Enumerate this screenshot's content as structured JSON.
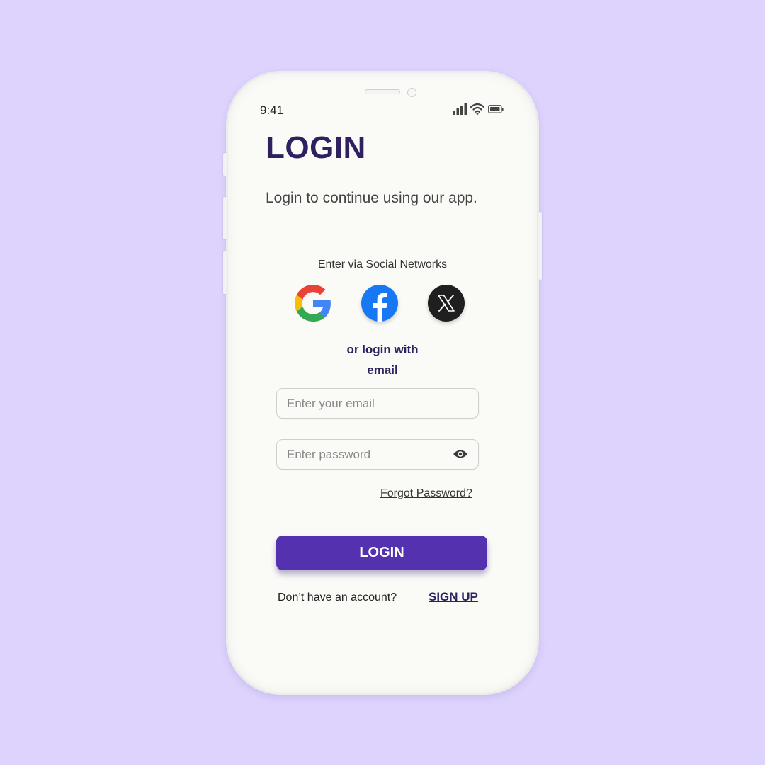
{
  "status_bar": {
    "time": "9:41",
    "icons": [
      "signal-icon",
      "wifi-icon",
      "battery-icon"
    ]
  },
  "header": {
    "title": "LOGIN",
    "subtitle": "Login to continue using our app."
  },
  "social": {
    "label": "Enter via Social Networks",
    "providers": [
      {
        "name": "google-icon"
      },
      {
        "name": "facebook-icon"
      },
      {
        "name": "x-icon"
      }
    ]
  },
  "email_divider": {
    "line1": "or login with",
    "line2": "email"
  },
  "form": {
    "email_placeholder": "Enter your email",
    "password_placeholder": "Enter password",
    "password_toggle_icon": "eye-icon",
    "forgot_password": "Forgot Password?",
    "login_button": "LOGIN"
  },
  "footer": {
    "prompt": "Don’t have an account?",
    "signup": "SIGN UP"
  },
  "colors": {
    "background": "#ddd3fd",
    "primary": "#5431ae",
    "title": "#2f2160",
    "screen": "#fafaf7"
  }
}
